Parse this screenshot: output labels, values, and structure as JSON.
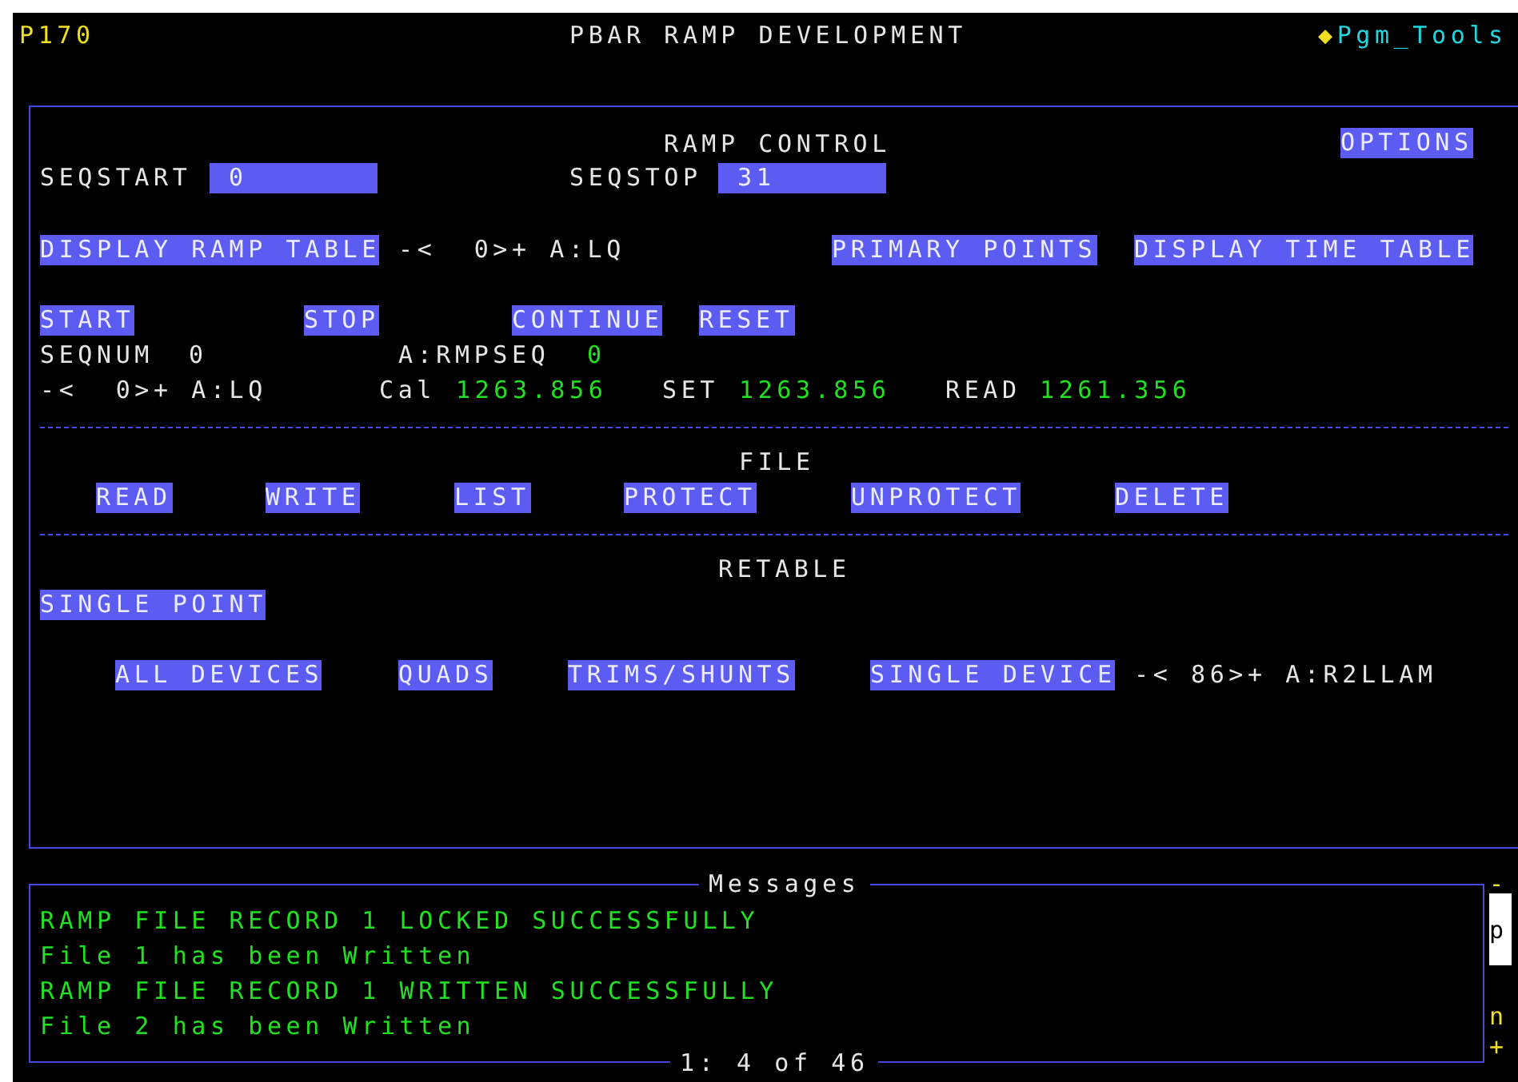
{
  "header": {
    "page": "P170",
    "title": "PBAR RAMP DEVELOPMENT",
    "menu_marker": "◆",
    "menu": "Pgm_Tools"
  },
  "ramp_control": {
    "title": "RAMP CONTROL",
    "options": "OPTIONS",
    "seqstart": {
      "label": "SEQSTART",
      "value": "0"
    },
    "seqstop": {
      "label": "SEQSTOP",
      "value": "31"
    },
    "display_controls": [
      {
        "kind": "button",
        "text": "DISPLAY RAMP TABLE"
      },
      {
        "kind": "text",
        "text": "-<  0>+ A:LQ"
      },
      {
        "kind": "button",
        "text": "PRIMARY POINTS"
      },
      {
        "kind": "button",
        "text": "DISPLAY TIME TABLE"
      }
    ],
    "run_buttons": [
      "START",
      "STOP",
      "CONTINUE",
      "RESET"
    ],
    "status": {
      "seqnum_label": "SEQNUM",
      "seqnum": "0",
      "rmpseq_label": "A:RMPSEQ",
      "rmpseq": "0"
    },
    "readback": {
      "device": "-<  0>+ A:LQ",
      "cal_label": "Cal",
      "cal": "1263.856",
      "set_label": "SET",
      "set": "1263.856",
      "read_label": "READ",
      "read": "1261.356"
    }
  },
  "file": {
    "title": "FILE",
    "buttons": [
      "READ",
      "WRITE",
      "LIST",
      "PROTECT",
      "UNPROTECT",
      "DELETE"
    ]
  },
  "retable": {
    "title": "RETABLE",
    "single_point": "SINGLE POINT",
    "items": [
      {
        "kind": "button",
        "text": "ALL DEVICES"
      },
      {
        "kind": "button",
        "text": "QUADS"
      },
      {
        "kind": "button",
        "text": "TRIMS/SHUNTS"
      },
      {
        "kind": "button",
        "text": "SINGLE DEVICE"
      },
      {
        "kind": "text",
        "text": "-< 86>+ A:R2LLAM"
      }
    ]
  },
  "messages": {
    "title": "Messages",
    "lines": [
      "RAMP FILE RECORD 1 LOCKED SUCCESSFULLY",
      "File 1 has been Written",
      "RAMP FILE RECORD 1 WRITTEN SUCCESSFULLY",
      "File 2 has been Written"
    ],
    "position": "1: 4 of 46",
    "scroll": {
      "up": "-",
      "page": "p",
      "next": "n",
      "down": "+"
    }
  }
}
